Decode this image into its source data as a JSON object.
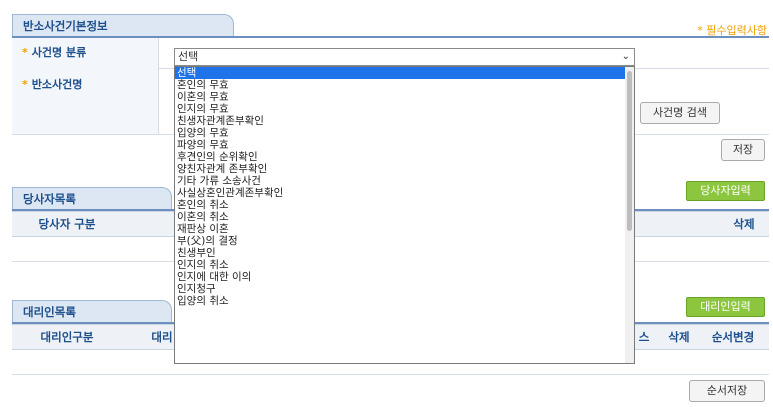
{
  "basic": {
    "title": "반소사건기본정보",
    "required_note": "* 필수입력사항",
    "category_label": "사건명 분류",
    "name_label": "반소사건명",
    "required_mark": "*",
    "search_button": "사건명 검색",
    "save_button": "저장"
  },
  "select": {
    "value": "선택",
    "options": [
      "선택",
      "혼인의 무효",
      "이혼의 무효",
      "인지의 무효",
      "친생자관계존부확인",
      "입양의 무효",
      "파양의 무효",
      "후견인의 순위확인",
      "양친자관계 존부확인",
      "기타 가류 소송사건",
      "사실상혼인관계존부확인",
      "혼인의 취소",
      "이혼의 취소",
      "재판상 이혼",
      "부(父)의 결정",
      "친생부인",
      "인지의 취소",
      "인지에 대한 이의",
      "인지청구",
      "입양의 취소"
    ]
  },
  "party": {
    "title": "당사자목록",
    "add_button": "당사자입력",
    "col_type": "당사자 구분",
    "col_delete": "삭제"
  },
  "agent": {
    "title": "대리인목록",
    "add_button": "대리인입력",
    "col_type": "대리인구분",
    "col_agent": "대리",
    "col_partial": "스",
    "col_delete": "삭제",
    "col_order": "순서변경",
    "order_save_button": "순서저장"
  }
}
